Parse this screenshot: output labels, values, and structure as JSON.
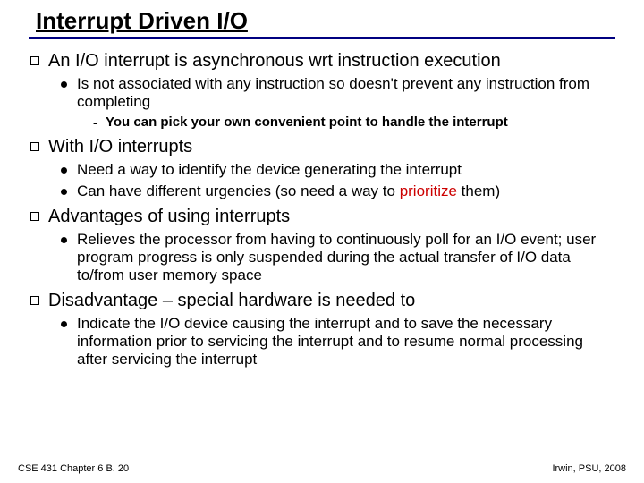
{
  "title_html": "<u>Interrupt Driven I/O</u>",
  "p1_html": "An I/O interrupt is <span class=\"async\">asynchronous</span> wrt instruction execution",
  "p1_s1": "Is not associated with any instruction so doesn't prevent any instruction from completing",
  "p1_s1_a": "You can pick your own convenient point to handle the interrupt",
  "p2": "With I/O interrupts",
  "p2_s1": "Need a way to identify the device generating the interrupt",
  "p2_s2_html": "Can have different urgencies (so need a way to <span class=\"prioritize\">prioritize</span> them)",
  "p3": "Advantages of using interrupts",
  "p3_s1": "Relieves the processor from having to continuously poll for an I/O event; user program progress is only suspended during the actual transfer of I/O data to/from user memory space",
  "p4": "Disadvantage – special hardware is needed to",
  "p4_s1": "Indicate the I/O device causing the interrupt and to save the necessary information prior to servicing the interrupt and to resume normal processing after servicing the interrupt",
  "footer_left": "CSE 431  Chapter 6 B. 20",
  "footer_right": "Irwin, PSU, 2008"
}
